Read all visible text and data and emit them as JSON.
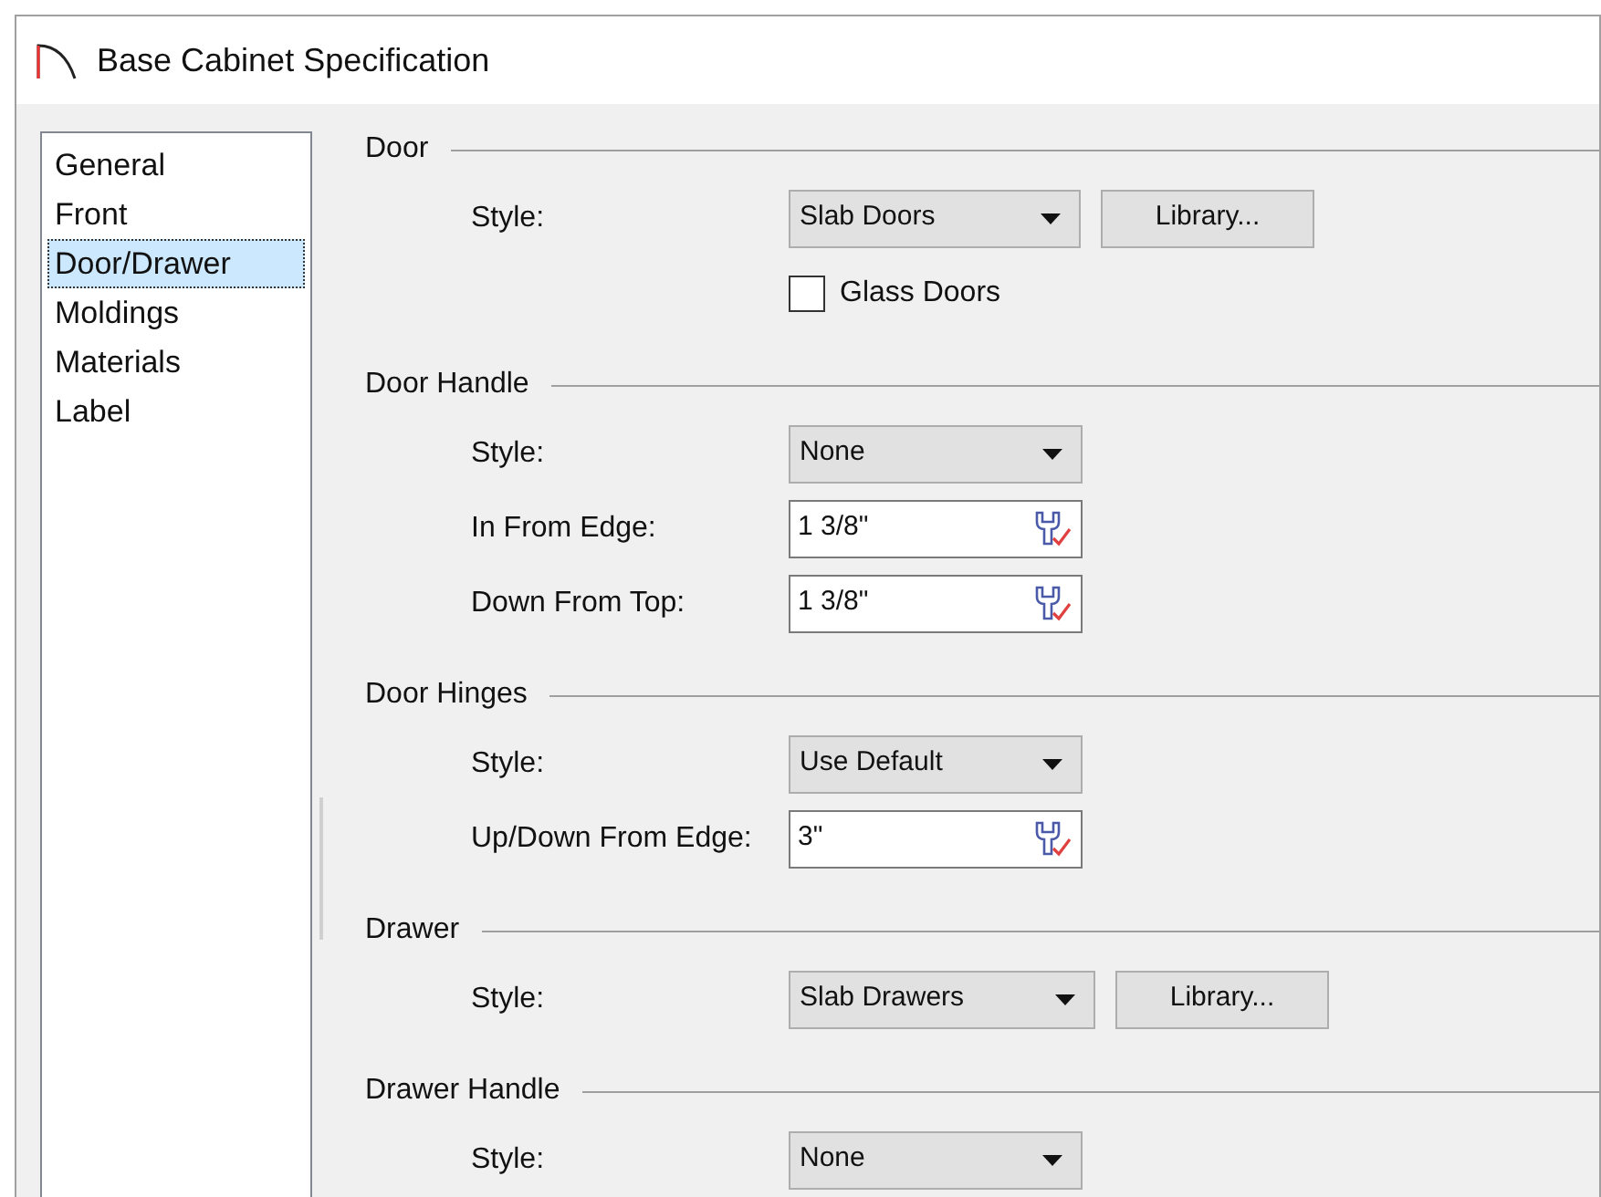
{
  "window": {
    "title": "Base Cabinet Specification"
  },
  "sidebar": {
    "items": [
      {
        "label": "General",
        "selected": false
      },
      {
        "label": "Front",
        "selected": false
      },
      {
        "label": "Door/Drawer",
        "selected": true
      },
      {
        "label": "Moldings",
        "selected": false
      },
      {
        "label": "Materials",
        "selected": false
      },
      {
        "label": "Label",
        "selected": false
      }
    ]
  },
  "sections": [
    {
      "title": "Door",
      "rows": [
        {
          "kind": "dropdown",
          "label": "Style:",
          "value": "Slab Doors",
          "button": "Library..."
        },
        {
          "kind": "checkbox",
          "label": "Glass Doors",
          "checked": false
        }
      ]
    },
    {
      "title": "Door Handle",
      "rows": [
        {
          "kind": "dropdown",
          "label": "Style:",
          "value": "None"
        },
        {
          "kind": "field",
          "label": "In From Edge:",
          "value": "1 3/8\""
        },
        {
          "kind": "field",
          "label": "Down From Top:",
          "value": "1 3/8\""
        }
      ]
    },
    {
      "title": "Door Hinges",
      "rows": [
        {
          "kind": "dropdown",
          "label": "Style:",
          "value": "Use Default"
        },
        {
          "kind": "field",
          "label": "Up/Down From Edge:",
          "value": "3\""
        }
      ]
    },
    {
      "title": "Drawer",
      "rows": [
        {
          "kind": "dropdown",
          "label": "Style:",
          "value": "Slab Drawers",
          "button": "Library..."
        }
      ]
    },
    {
      "title": "Drawer Handle",
      "rows": [
        {
          "kind": "dropdown",
          "label": "Style:",
          "value": "None"
        }
      ]
    }
  ]
}
